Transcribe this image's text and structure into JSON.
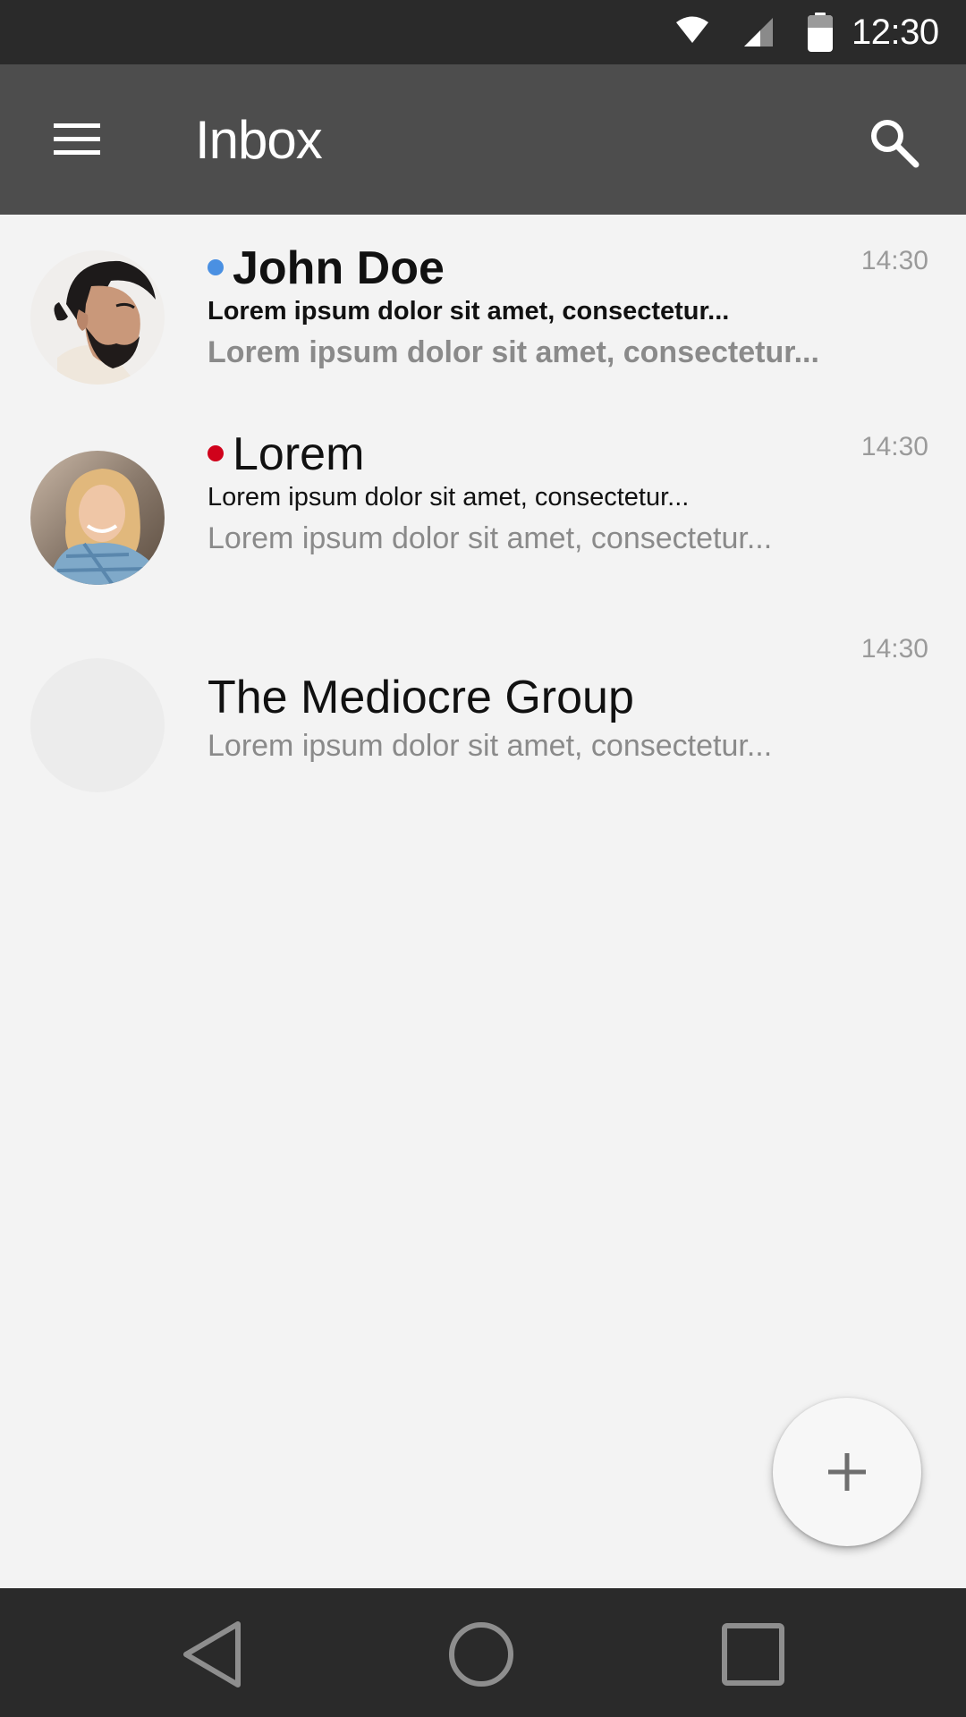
{
  "status_bar": {
    "time": "12:30",
    "icons": [
      "wifi-icon",
      "signal-icon",
      "battery-icon"
    ]
  },
  "app_bar": {
    "title": "Inbox",
    "icons": [
      "menu-icon",
      "search-icon"
    ]
  },
  "messages": [
    {
      "sender": "John Doe",
      "subject": "Lorem ipsum dolor sit amet, consectetur...",
      "preview": "Lorem ipsum dolor sit amet, consectetur...",
      "time": "14:30",
      "unread": true,
      "dot_color": "#4a90e2",
      "avatar": "man-avatar"
    },
    {
      "sender": "Lorem",
      "subject": "Lorem ipsum dolor sit amet, consectetur...",
      "preview": "Lorem ipsum dolor sit amet, consectetur...",
      "time": "14:30",
      "unread": false,
      "dot_color": "#d0021b",
      "avatar": "woman-avatar"
    },
    {
      "sender": "The Mediocre Group",
      "preview": "Lorem ipsum dolor sit amet, consectetur...",
      "time": "14:30",
      "avatar": "empty-avatar"
    }
  ],
  "fab": {
    "icon": "plus-icon"
  },
  "nav_bar": {
    "icons": [
      "back-icon",
      "home-icon",
      "recents-icon"
    ]
  },
  "colors": {
    "status_bar": "#2a2a2a",
    "app_bar": "#4d4d4d",
    "background": "#f3f3f3",
    "secondary_text": "#8a8a8a",
    "blue_dot": "#4a90e2",
    "red_dot": "#d0021b"
  }
}
